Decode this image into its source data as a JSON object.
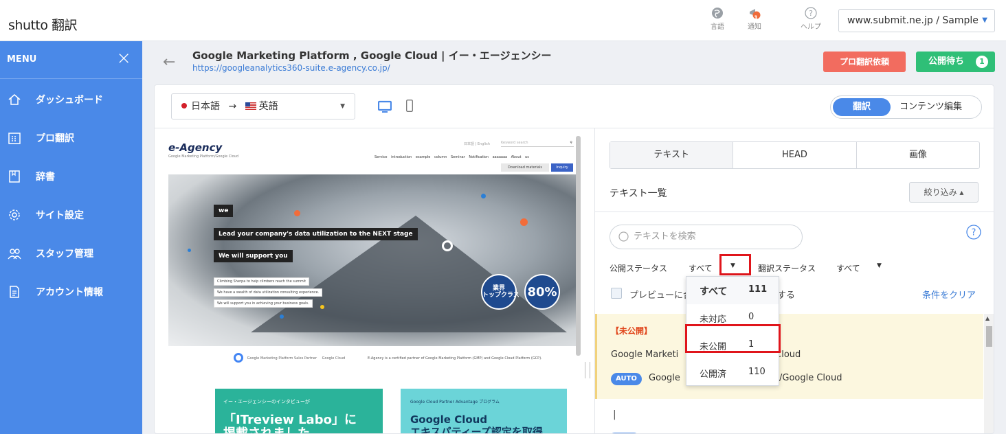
{
  "app": {
    "logo": "shutto 翻訳"
  },
  "topbar": {
    "lang_label": "言語",
    "notify_label": "通知",
    "notify_count": "1",
    "help_label": "ヘルプ",
    "site_select": "www.submit.ne.jp / Sample"
  },
  "sidebar": {
    "menu_label": "MENU",
    "items": [
      {
        "label": "ダッシュボード",
        "icon": "house-icon"
      },
      {
        "label": "プロ翻訳",
        "icon": "calendar-icon"
      },
      {
        "label": "辞書",
        "icon": "book-icon"
      },
      {
        "label": "サイト設定",
        "icon": "gear-icon"
      },
      {
        "label": "スタッフ管理",
        "icon": "people-icon"
      },
      {
        "label": "アカウント情報",
        "icon": "document-icon"
      }
    ]
  },
  "header": {
    "title": "Google Marketing Platform , Google Cloud | イー・エージェンシー",
    "url": "https://googleanalytics360-suite.e-agency.co.jp/",
    "pro_button": "プロ翻訳依頼",
    "publish_button": "公開待ち",
    "publish_count": "1"
  },
  "toolbar": {
    "lang_from": "日本語",
    "arrow": "→",
    "lang_to": "英語",
    "mode_translate": "翻訳",
    "mode_content": "コンテンツ編集"
  },
  "preview": {
    "logo": "e-Agency",
    "sub": "Google Marketing Platform/Google Cloud",
    "lang_links": "日本語 | English",
    "search_placeholder": "Keyword search",
    "nav": "Service introduction   example   column   Seminar   Notification aaaaaaa   About us",
    "download": "Download materials",
    "inquiry": "Inquiry",
    "tag_we": "we",
    "tag_lead": "Lead your company's data utilization to the NEXT stage",
    "tag_support": "We will support you",
    "small1": "Climbing Sherpa to help climbers reach the summit",
    "small2": "We have a wealth of data utilization consulting experience.",
    "small3": "We will support you in achieving your business goals.",
    "badge1": "業界\nトップクラス",
    "badge2": "80%",
    "partner_text": "E-Agency is a certified partner of Google Marketing Platform (GMP) and Google Cloud Platform (GCP).",
    "partner_gmp": "Google Marketing Platform Sales Partner",
    "partner_gc": "Google Cloud",
    "card1_sub": "イー・エージェンシーのインタビューが",
    "card1_title": "「ITreview Labo」に\n掲載されました",
    "card2_sub": "Google Cloud Partner Advantage プログラム",
    "card2_title": "Google Cloud\nエキスパティーズ認定を取得"
  },
  "right": {
    "tabs": [
      "テキスト",
      "HEAD",
      "画像"
    ],
    "list_title": "テキスト一覧",
    "filter_button": "絞り込み ▴",
    "search_placeholder": "テキストを検索",
    "pub_status_label": "公開ステータス",
    "pub_status_value": "すべて",
    "trans_status_label": "翻訳ステータス",
    "trans_status_value": "すべて",
    "preview_check_label": "プレビューに合",
    "preview_check_label2": "する",
    "clear_label": "条件をクリア",
    "item1_status": "【未公開】",
    "item1_source": "Google Marketi",
    "item1_source_tail": "e Cloud",
    "item1_auto": "AUTO",
    "item1_translation": "Google",
    "item1_translation_tail": "/Google Cloud",
    "item2_text": "|"
  },
  "dropdown": {
    "options": [
      {
        "label": "すべて",
        "count": "111"
      },
      {
        "label": "未対応",
        "count": "0"
      },
      {
        "label": "未公開",
        "count": "1"
      },
      {
        "label": "公開済",
        "count": "110"
      }
    ]
  },
  "colors": {
    "sidebar": "#4a89e8",
    "pro_button": "#f26c5f",
    "publish_button": "#2fbf77",
    "highlight": "#e0151b"
  }
}
